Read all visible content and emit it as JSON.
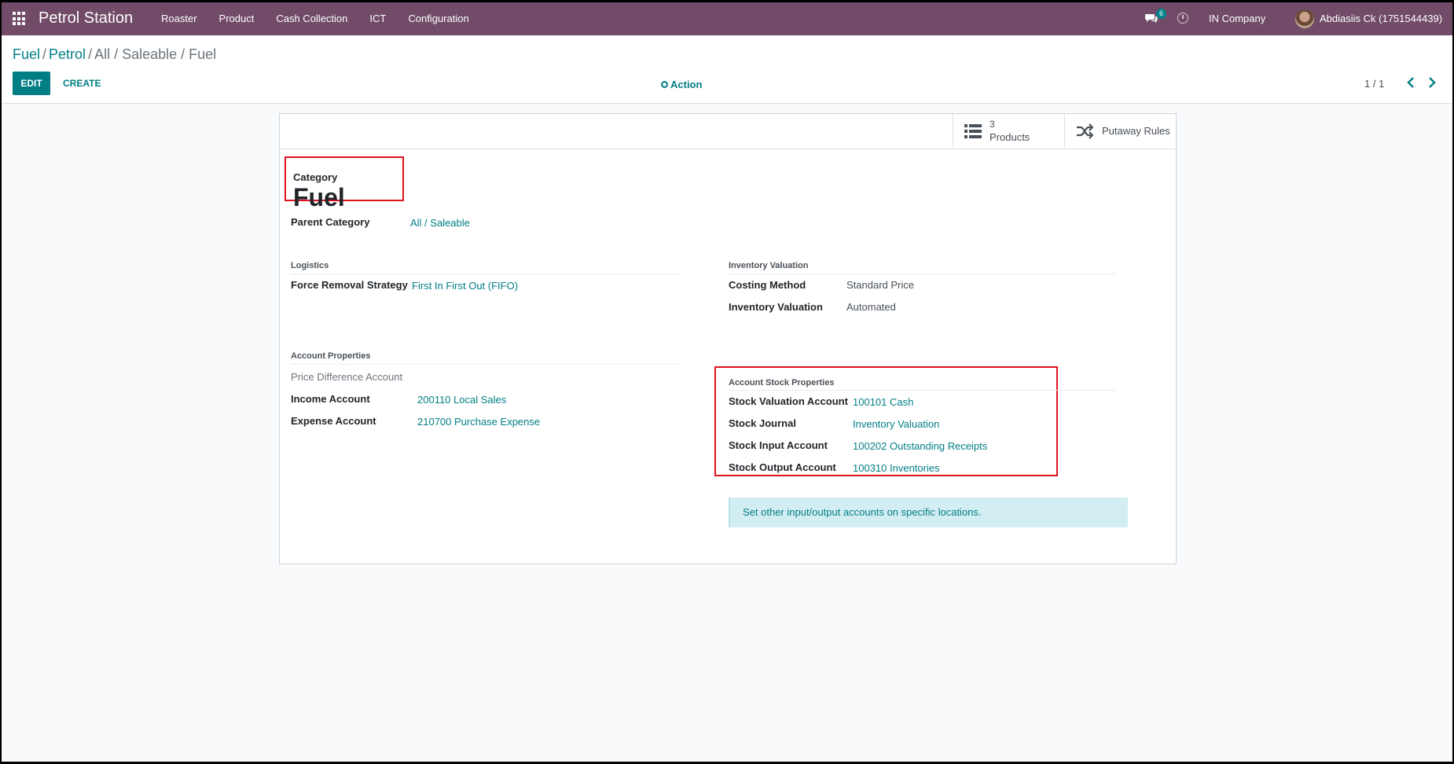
{
  "navbar": {
    "brand": "Petrol Station",
    "menu": [
      "Roaster",
      "Product",
      "Cash Collection",
      "ICT",
      "Configuration"
    ],
    "chat_count": "6",
    "company": "IN Company",
    "user": "Abdiasiis Ck (1751544439)"
  },
  "breadcrumb": {
    "items": [
      "Fuel",
      "Petrol"
    ],
    "current": "All / Saleable / Fuel",
    "sep": "/"
  },
  "control": {
    "edit_label": "EDIT",
    "create_label": "CREATE",
    "action_label": "Action",
    "pager": "1 / 1"
  },
  "buttons": {
    "products_count": "3",
    "products_label": "Products",
    "putaway_label": "Putaway Rules"
  },
  "category": {
    "label": "Category",
    "name": "Fuel",
    "parent_label": "Parent Category",
    "parent_value": "All / Saleable"
  },
  "logistics": {
    "title": "Logistics",
    "removal_label": "Force Removal Strategy",
    "removal_value": "First In First Out (FIFO)"
  },
  "inventory_valuation": {
    "title": "Inventory Valuation",
    "costing_label": "Costing Method",
    "costing_value": "Standard Price",
    "valuation_label": "Inventory Valuation",
    "valuation_value": "Automated"
  },
  "account_properties": {
    "title": "Account Properties",
    "price_diff_label": "Price Difference Account",
    "income_label": "Income Account",
    "income_value": "200110 Local Sales",
    "expense_label": "Expense Account",
    "expense_value": "210700 Purchase Expense"
  },
  "account_stock": {
    "title": "Account Stock Properties",
    "valuation_label": "Stock Valuation Account",
    "valuation_value": "100101 Cash",
    "journal_label": "Stock Journal",
    "journal_value": "Inventory Valuation",
    "input_label": "Stock Input Account",
    "input_value": "100202 Outstanding Receipts",
    "output_label": "Stock Output Account",
    "output_value": "100310 Inventories",
    "info": "Set other input/output accounts on specific locations."
  },
  "colors": {
    "navbar": "#714b67",
    "accent": "#017e84",
    "highlight": "#e0141e",
    "info_bg": "#d3eef3"
  }
}
